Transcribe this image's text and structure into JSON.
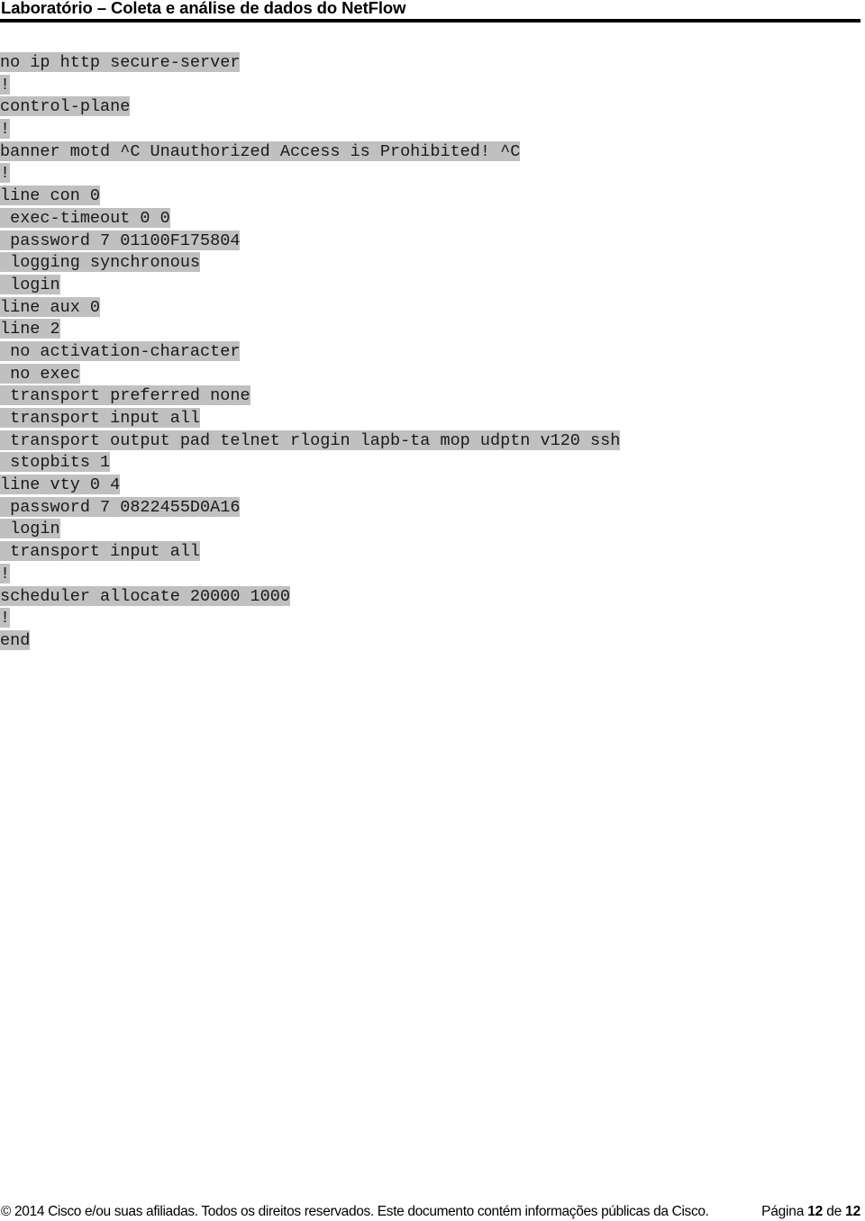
{
  "header": {
    "title": "Laboratório – Coleta e análise de dados do NetFlow"
  },
  "config": {
    "lines": [
      "no ip http secure-server",
      "!",
      "control-plane",
      "!",
      "banner motd ^C Unauthorized Access is Prohibited! ^C",
      "!",
      "line con 0",
      " exec-timeout 0 0",
      " password 7 01100F175804",
      " logging synchronous",
      " login",
      "line aux 0",
      "line 2",
      " no activation-character",
      " no exec",
      " transport preferred none",
      " transport input all",
      " transport output pad telnet rlogin lapb-ta mop udptn v120 ssh",
      " stopbits 1",
      "line vty 0 4",
      " password 7 0822455D0A16",
      " login",
      " transport input all",
      "!",
      "scheduler allocate 20000 1000",
      "!",
      "end"
    ]
  },
  "footer": {
    "copyright": "© 2014 Cisco e/ou suas afiliadas. Todos os direitos reservados. Este documento contém informações públicas da Cisco.",
    "page_label": "Página",
    "page_current": "12",
    "page_of": "de",
    "page_total": "12"
  }
}
